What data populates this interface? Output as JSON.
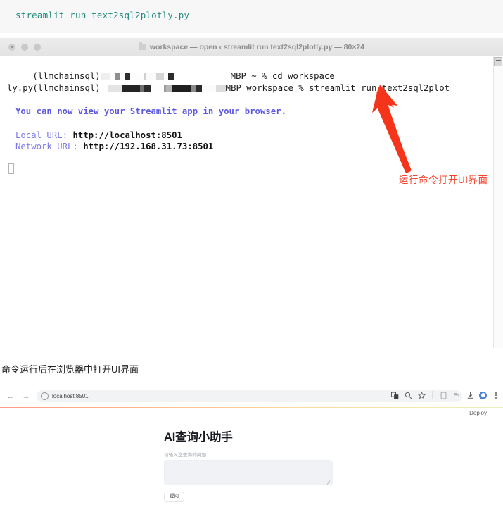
{
  "code_block": {
    "command": "streamlit run text2sql2plotly.py"
  },
  "terminal": {
    "title": "workspace — open ‹ streamlit run text2sql2plotly.py — 80×24",
    "folder_icon": "folder-icon",
    "traffic_lights": [
      "close-button",
      "minimize-button",
      "zoom-button"
    ],
    "line1_prefix": "(llmchainsql)",
    "line1_suffix": "MBP ~ % cd workspace",
    "line2_prefix": "(llmchainsql)",
    "line2_suffix": "MBP workspace % streamlit run text2sql2plot",
    "line3": "ly.py",
    "message_view": "You can now view your Streamlit app in your browser.",
    "local_label": "Local URL: ",
    "local_url": "http://localhost:8501",
    "network_label": "Network URL: ",
    "network_url": "http://192.168.31.73:8501",
    "cursor": "block-cursor"
  },
  "annotations": {
    "arrow_color": "#f4351c",
    "red_note": "运行命令打开UI界面",
    "caption": "命令运行后在浏览器中打开UI界面"
  },
  "browser": {
    "back_icon": "←",
    "forward_icon": "→",
    "reload_icon": "⟳",
    "url": "localhost:8501",
    "toolbar_icons": [
      "translate-icon",
      "search-icon",
      "bookmark-star-icon",
      "tab-search-icon",
      "extensions-icon",
      "download-icon",
      "profile-avatar-icon",
      "more-menu-icon"
    ]
  },
  "streamlit_app": {
    "deploy_label": "Deploy",
    "menu_icon": "hamburger-menu-icon",
    "title": "AI查询小助手",
    "input_label": "请输入您查询的问题",
    "input_value": "",
    "submit_label": "提问"
  }
}
